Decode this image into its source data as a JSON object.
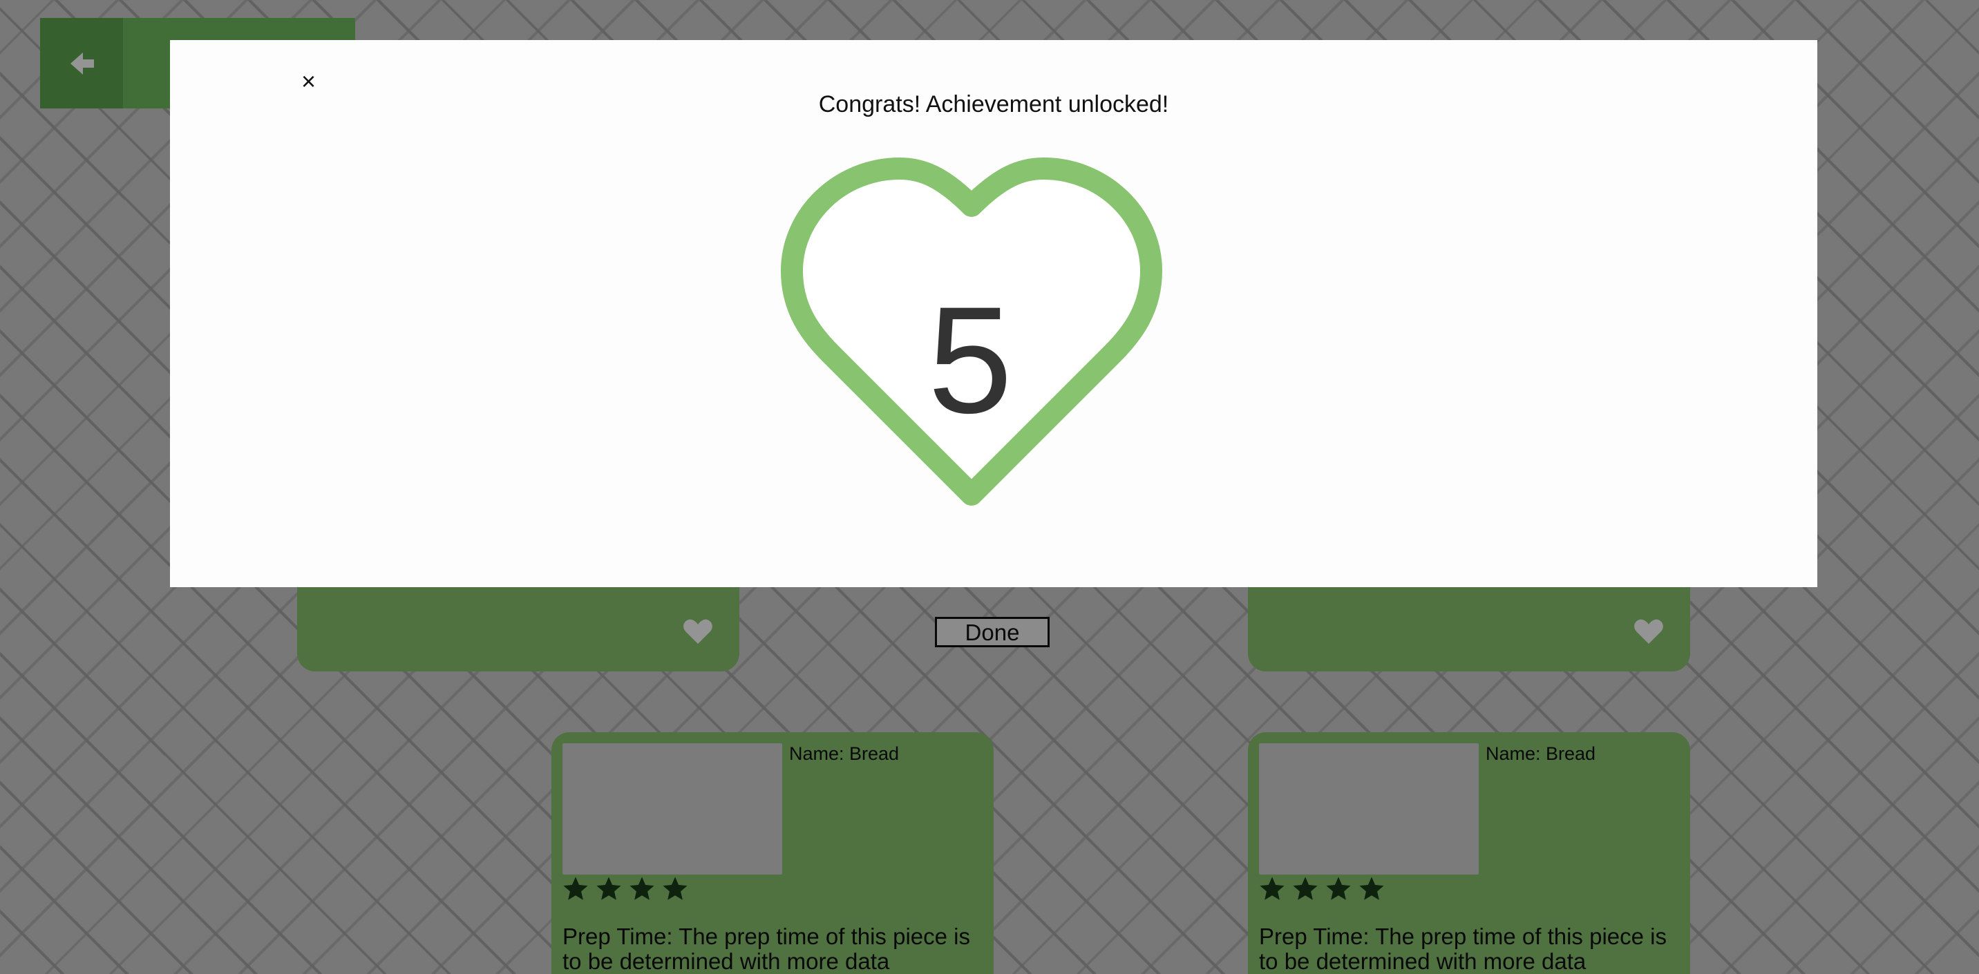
{
  "colors": {
    "accent": "#88c46f",
    "accent_dark": "#5ea64e",
    "star": "#1b3b17",
    "overlay": "rgba(0,0,0,0.42)"
  },
  "header": {
    "back_icon": "arrow-left-icon"
  },
  "cards_top": [
    {
      "favorite_icon": "heart-icon"
    },
    {
      "favorite_icon": "heart-icon"
    }
  ],
  "cards": [
    {
      "name": "Name: Bread",
      "rating": 4,
      "prep": "Prep Time: The prep time of this piece is to be determined with more data"
    },
    {
      "name": "Name: Bread",
      "rating": 4,
      "prep": "Prep Time: The prep time of this piece is to be determined with more data"
    }
  ],
  "done_label": "Done",
  "modal": {
    "close_label": "×",
    "title": "Congrats! Achievement unlocked!",
    "badge_icon": "heart-icon",
    "badge_count": "5"
  }
}
